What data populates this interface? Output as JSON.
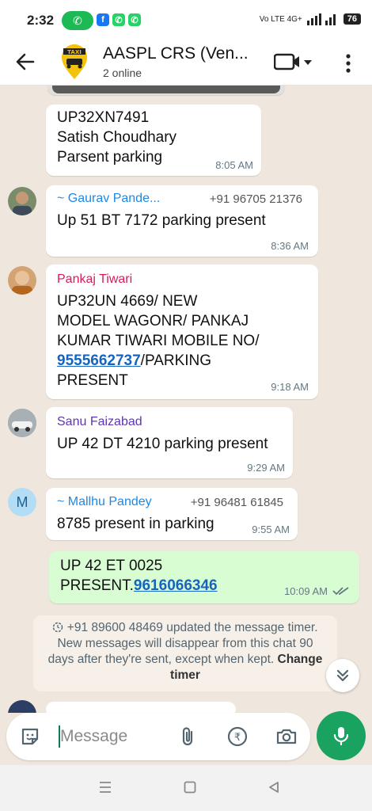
{
  "status_bar": {
    "time": "2:32",
    "network": "Vo LTE 4G+",
    "battery": "76"
  },
  "header": {
    "title": "AASPL CRS (Ven...",
    "subtitle": "2 online",
    "logo_text": "TAXI"
  },
  "messages": [
    {
      "text": "UP32XN7491\nSatish Choudhary\nParsent parking",
      "time": "8:05 AM"
    },
    {
      "sender": "~ Gaurav Pande...",
      "phone": "+91 96705 21376",
      "text": "Up 51 BT 7172 parking present",
      "time": "8:36 AM"
    },
    {
      "sender": "Pankaj Tiwari",
      "text_before": "UP32UN 4669/ NEW\nMODEL WAGONR/ PANKAJ\nKUMAR TIWARI MOBILE NO/\n",
      "link": "9555662737",
      "text_after": "/PARKING\nPRESENT",
      "time": "9:18 AM"
    },
    {
      "sender": "Sanu Faizabad",
      "text": "UP 42 DT 4210 parking present",
      "time": "9:29 AM"
    },
    {
      "sender": "~ Mallhu Pandey",
      "phone": "+91 96481 61845",
      "text": "8785 present in parking",
      "time": "9:55 AM",
      "avatar_letter": "M"
    },
    {
      "text_before": "UP 42 ET 0025\nPRESENT.",
      "link": "9616066346",
      "time": "10:09 AM",
      "outgoing": true
    }
  ],
  "system_message": {
    "text": "+91 89600 48469 updated the message timer. New messages will disappear from this chat 90 days after they're sent, except when kept.",
    "action": "Change timer"
  },
  "input": {
    "placeholder": "Message"
  },
  "colors": {
    "accent": "#1aa260",
    "outgoing_bubble": "#d9fdd3",
    "link": "#1565c0",
    "sender_gaurav": "#1e88e5",
    "sender_pankaj": "#d81b60",
    "sender_sanu": "#5e35b1",
    "sender_mallhu": "#1e88e5"
  }
}
